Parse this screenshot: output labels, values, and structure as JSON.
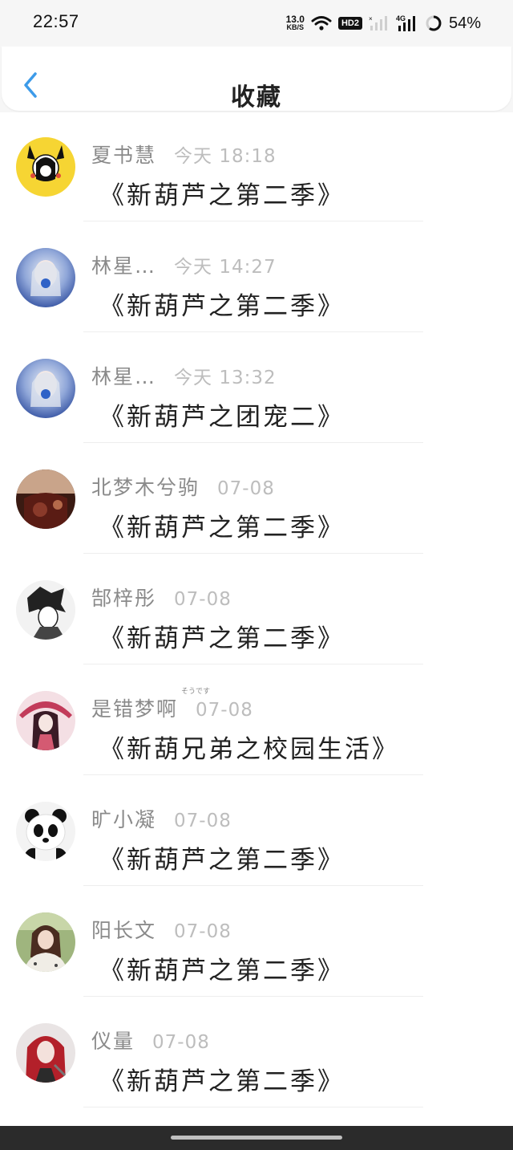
{
  "status": {
    "time": "22:57",
    "net_speed": "13.0",
    "net_unit": "KB/S",
    "hd_label": "HD2",
    "network_label": "4G",
    "battery": "54%",
    "icons": [
      "wifi-icon",
      "signal-icon",
      "battery-ring-icon"
    ]
  },
  "header": {
    "title": "收藏",
    "back_icon": "chevron-left-icon",
    "accent_color": "#3d9be9"
  },
  "items": [
    {
      "name": "夏书慧",
      "time": "今天 18:18",
      "book": "《新葫芦之第二季》",
      "avatar": "avatar-pikachu"
    },
    {
      "name": "林星…",
      "time": "今天 14:27",
      "book": "《新葫芦之第二季》",
      "avatar": "avatar-blue-girl"
    },
    {
      "name": "林星…",
      "time": "今天 13:32",
      "book": "《新葫芦之团宠二》",
      "avatar": "avatar-blue-girl"
    },
    {
      "name": "北梦木兮驹",
      "time": "07-08",
      "book": "《新葫芦之第二季》",
      "avatar": "avatar-dark-red"
    },
    {
      "name": "郜梓彤",
      "time": "07-08",
      "book": "《新葫芦之第二季》",
      "avatar": "avatar-sketch"
    },
    {
      "name": "是错梦啊",
      "ruby": "そうです",
      "time": "07-08",
      "book": "《新葫兄弟之校园生活》",
      "avatar": "avatar-pink-anime"
    },
    {
      "name": "旷小凝",
      "time": "07-08",
      "book": "《新葫芦之第二季》",
      "avatar": "avatar-panda"
    },
    {
      "name": "阳长文",
      "time": "07-08",
      "book": "《新葫芦之第二季》",
      "avatar": "avatar-girl-photo"
    },
    {
      "name": "仪量",
      "time": "07-08",
      "book": "《新葫芦之第二季》",
      "avatar": "avatar-red-hair"
    }
  ]
}
